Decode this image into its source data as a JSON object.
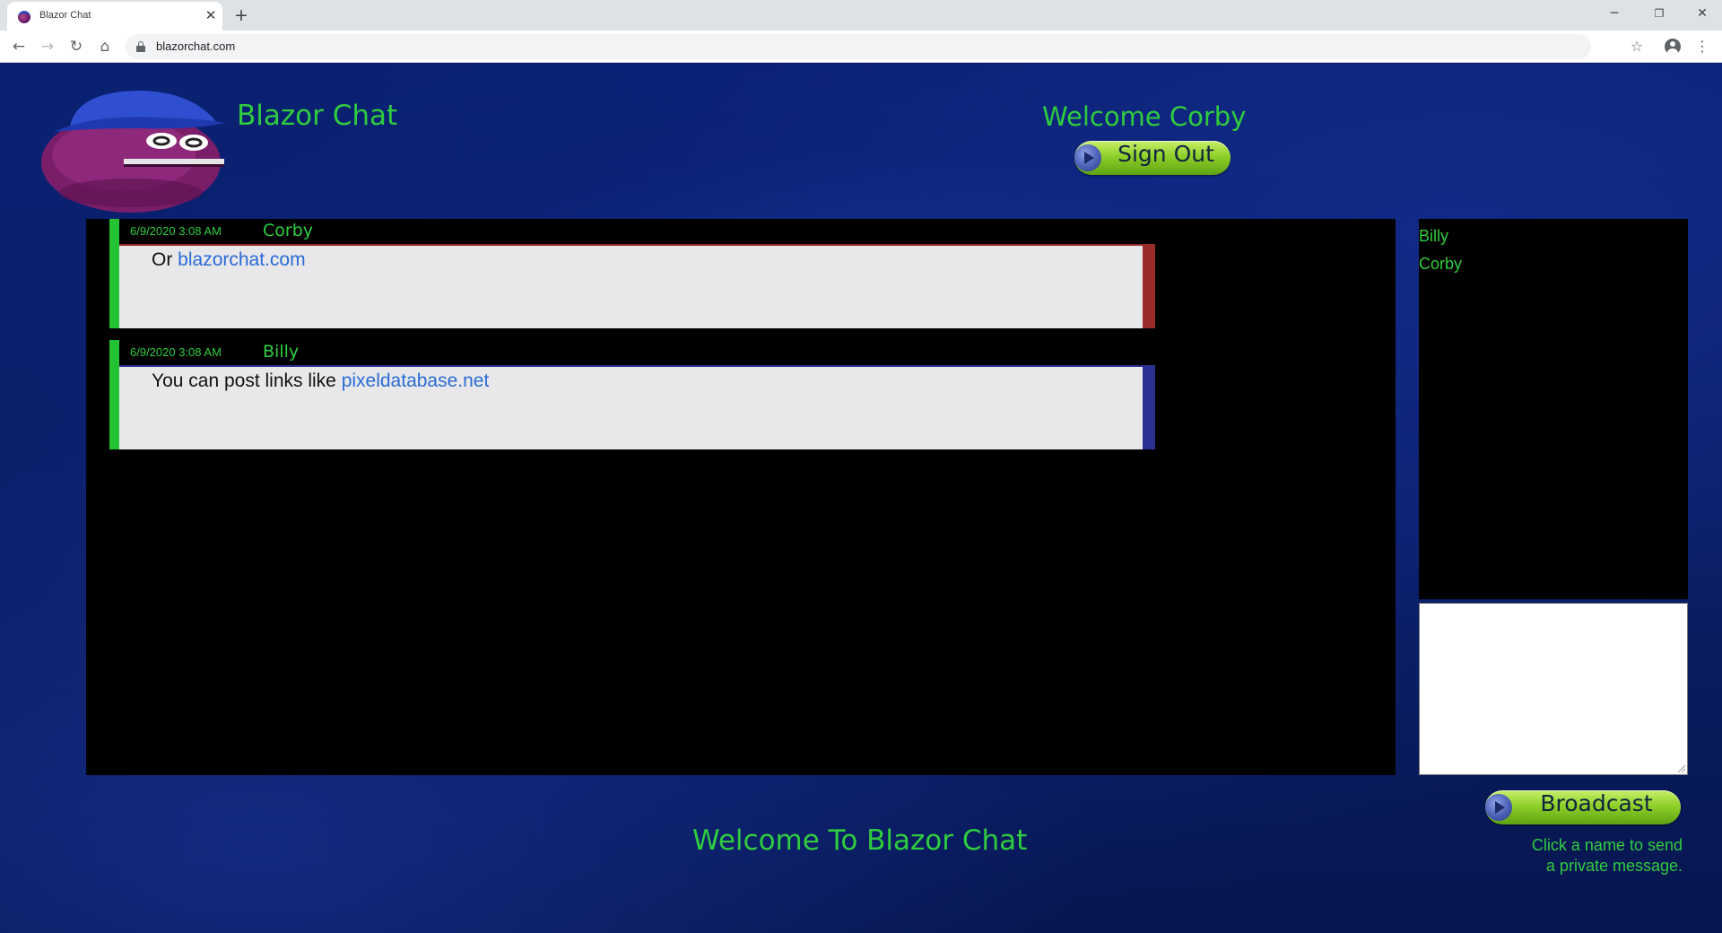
{
  "browser": {
    "tab_title": "Blazor Chat",
    "url": "blazorchat.com",
    "tab_close_glyph": "✕",
    "new_tab_glyph": "+",
    "back_glyph": "←",
    "forward_glyph": "→",
    "reload_glyph": "↻",
    "home_glyph": "⌂",
    "star_glyph": "☆",
    "menu_glyph": "⋮",
    "minimize_glyph": "─",
    "restore_glyph": "❐",
    "close_glyph": "✕"
  },
  "header": {
    "title": "Blazor Chat",
    "welcome": "Welcome Corby",
    "sign_out_label": "Sign Out"
  },
  "messages": [
    {
      "time": "6/9/2020 3:08 AM",
      "user": "Corby",
      "text": "Or ",
      "link": "blazorchat.com",
      "edge_color": "#9b2b2b"
    },
    {
      "time": "6/9/2020 3:08 AM",
      "user": "Billy",
      "text": "You can post links like ",
      "link": "pixeldatabase.net",
      "edge_color": "#2a3192"
    }
  ],
  "users": [
    "Billy",
    "Corby"
  ],
  "compose": {
    "value": "",
    "broadcast_label": "Broadcast",
    "hint_line1": "Click a name to send",
    "hint_line2": "a private message."
  },
  "footer": {
    "title": "Welcome To Blazor Chat"
  },
  "colors": {
    "accent_green": "#2fcc3f",
    "page_blue": "#0a1d6b",
    "link_blue": "#2a6ad6"
  },
  "icons": [
    "favicon-icon",
    "lock-icon",
    "star-icon",
    "profile-icon",
    "menu-icon",
    "logo-mascot",
    "arrow-icon"
  ]
}
